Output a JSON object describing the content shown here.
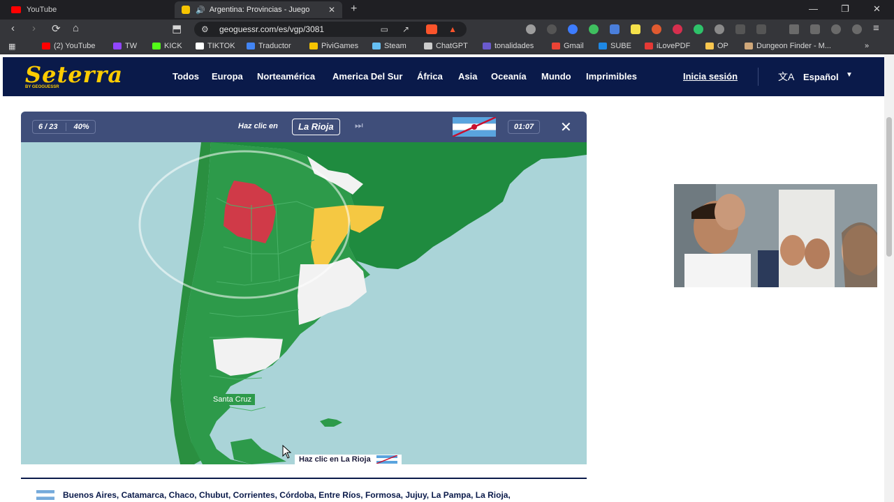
{
  "browser": {
    "tabs": [
      {
        "title": "YouTube",
        "favicon": "youtube-icon"
      },
      {
        "title": "Argentina: Provincias - Juego",
        "favicon": "seterra-icon",
        "audio": true
      }
    ],
    "url": "geoguessr.com/es/vgp/3081",
    "bookmarks": [
      {
        "label": "(2) YouTube",
        "icon": "youtube-icon",
        "color": "#ff0000"
      },
      {
        "label": "TW",
        "icon": "twitch-icon",
        "color": "#9146ff"
      },
      {
        "label": "KICK",
        "icon": "kick-icon",
        "color": "#53fc18"
      },
      {
        "label": "TIKTOK",
        "icon": "tiktok-icon",
        "color": "#ffffff"
      },
      {
        "label": "Traductor",
        "icon": "translate-icon",
        "color": "#4285f4"
      },
      {
        "label": "PiviGames",
        "icon": "pivi-icon",
        "color": "#f6c400"
      },
      {
        "label": "Steam",
        "icon": "steam-icon",
        "color": "#66c0f4"
      },
      {
        "label": "ChatGPT",
        "icon": "chatgpt-icon",
        "color": "#cccccc"
      },
      {
        "label": "tonalidades",
        "icon": "palette-icon",
        "color": "#6a5acd"
      },
      {
        "label": "Gmail",
        "icon": "gmail-icon",
        "color": "#ea4335"
      },
      {
        "label": "SUBE",
        "icon": "sube-icon",
        "color": "#1e88e5"
      },
      {
        "label": "iLovePDF",
        "icon": "pdf-icon",
        "color": "#e53935"
      },
      {
        "label": "OP",
        "icon": "op-icon",
        "color": "#f9c74f"
      },
      {
        "label": "Dungeon Finder - M...",
        "icon": "dungeon-icon",
        "color": "#cfa77a"
      }
    ]
  },
  "site": {
    "logo": "Seterra",
    "logo_sub": "BY GEOGUESSR",
    "nav": [
      "Todos",
      "Europa",
      "Norteamérica",
      "America Del Sur",
      "África",
      "Asia",
      "Oceanía",
      "Mundo",
      "Imprimibles"
    ],
    "login": "Inicia sesión",
    "language": "Español"
  },
  "game": {
    "progress": "6 / 23",
    "score": "40%",
    "prompt_label": "Haz clic en",
    "target": "La Rioja",
    "timer": "01:07",
    "map_label": "Santa Cruz",
    "hint": "Haz clic en La Rioja",
    "colors": {
      "correct": "#2d9a4a",
      "wrong": "#d03a48",
      "partial": "#f5c842",
      "unanswered": "#f2f2f2",
      "sea": "#aad4d8",
      "other": "#1f8b3f"
    }
  },
  "footer": {
    "list": "Buenos Aires, Catamarca, Chaco, Chubut, Corrientes, Córdoba, Entre Ríos, Formosa, Jujuy, La Pampa, La Rioja,"
  }
}
